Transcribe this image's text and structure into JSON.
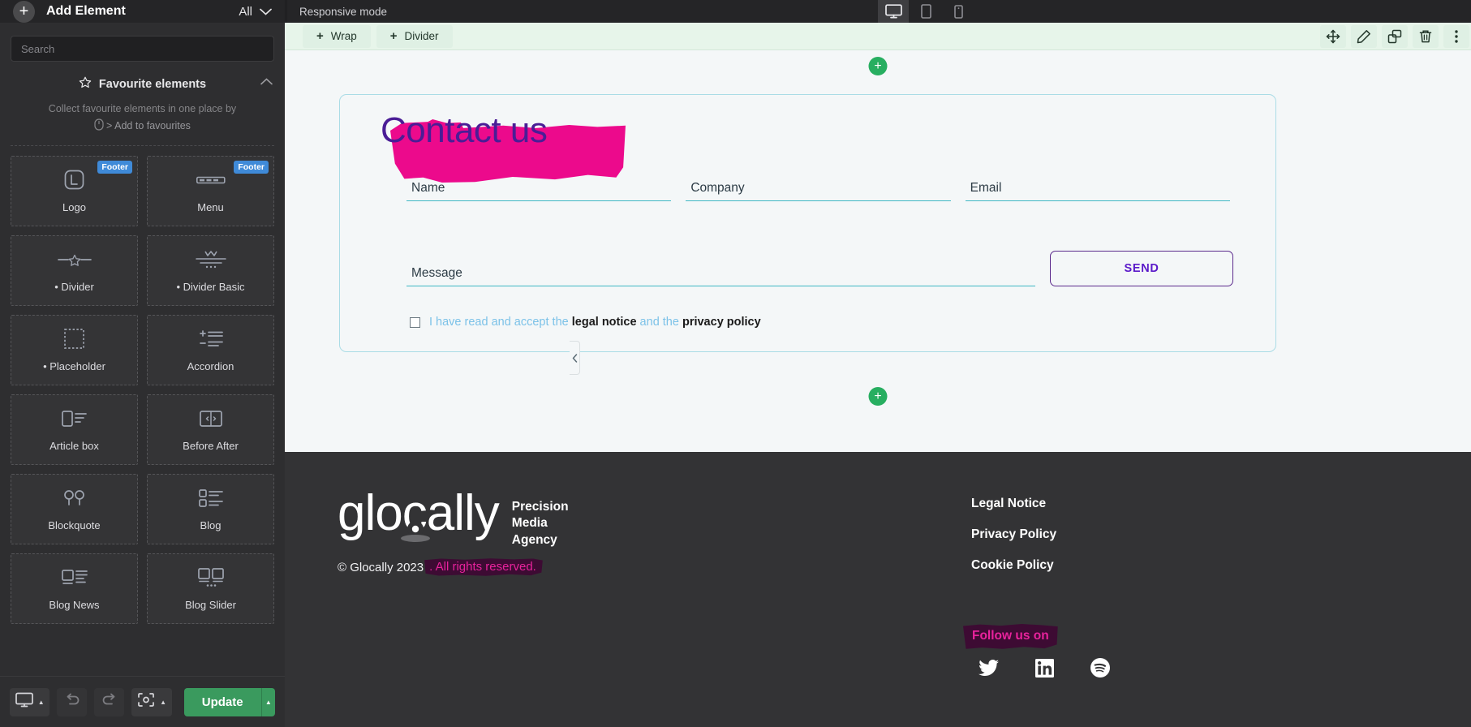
{
  "sidebar": {
    "add_element_label": "Add Element",
    "filter_label": "All",
    "search_placeholder": "Search",
    "favourites": {
      "title": "Favourite elements",
      "description": "Collect favourite elements in one place by",
      "hint": "> Add to favourites"
    },
    "elements": [
      {
        "label": "Logo",
        "icon": "logo-icon",
        "badge": "Footer"
      },
      {
        "label": "Menu",
        "icon": "menu-icon",
        "badge": "Footer"
      },
      {
        "label": "• Divider",
        "icon": "divider-icon",
        "badge": ""
      },
      {
        "label": "• Divider Basic",
        "icon": "divider-basic-icon",
        "badge": ""
      },
      {
        "label": "• Placeholder",
        "icon": "placeholder-icon",
        "badge": ""
      },
      {
        "label": "Accordion",
        "icon": "accordion-icon",
        "badge": ""
      },
      {
        "label": "Article box",
        "icon": "article-box-icon",
        "badge": ""
      },
      {
        "label": "Before After",
        "icon": "before-after-icon",
        "badge": ""
      },
      {
        "label": "Blockquote",
        "icon": "blockquote-icon",
        "badge": ""
      },
      {
        "label": "Blog",
        "icon": "blog-icon",
        "badge": ""
      },
      {
        "label": "Blog News",
        "icon": "blog-news-icon",
        "badge": ""
      },
      {
        "label": "Blog Slider",
        "icon": "blog-slider-icon",
        "badge": ""
      }
    ],
    "footer_bar": {
      "update_label": "Update"
    }
  },
  "topbar": {
    "responsive_mode_label": "Responsive mode",
    "devices": [
      "desktop",
      "tablet",
      "mobile"
    ],
    "active_device": "desktop"
  },
  "edit_toolbar": {
    "wrap_label": "Wrap",
    "divider_label": "Divider",
    "plus": "+",
    "icons": [
      "move-icon",
      "edit-icon",
      "duplicate-icon",
      "delete-icon",
      "more-icon"
    ]
  },
  "canvas": {
    "add_button_label": "+",
    "form": {
      "heading": "Contact us",
      "fields": [
        {
          "label": "Name"
        },
        {
          "label": "Company"
        },
        {
          "label": "Email"
        }
      ],
      "message_label": "Message",
      "send_label": "SEND",
      "consent": {
        "prefix": "I have read and accept the ",
        "link1": "legal notice",
        "middle": " and the ",
        "link2": "privacy policy"
      }
    }
  },
  "site_footer": {
    "logo_text": "glocally",
    "logo_tagline": [
      "Precision",
      "Media",
      "Agency"
    ],
    "copyright_plain": "© Glocally 2023",
    "copyright_highlight": ". All rights reserved.",
    "links": [
      "Legal Notice",
      "Privacy Policy",
      "Cookie Policy"
    ],
    "follow_label": "Follow us on",
    "socials": [
      "twitter-icon",
      "linkedin-icon",
      "spotify-icon"
    ]
  },
  "colors": {
    "accent_green": "#27ae60",
    "marker_pink": "#ec0a8c",
    "heading_purple": "#4a1d96",
    "field_underline": "#3fb8c4",
    "send_purple": "#5a19c9",
    "consent_blue": "#7cc2e8",
    "highlight_dark": "#3d0b33"
  }
}
